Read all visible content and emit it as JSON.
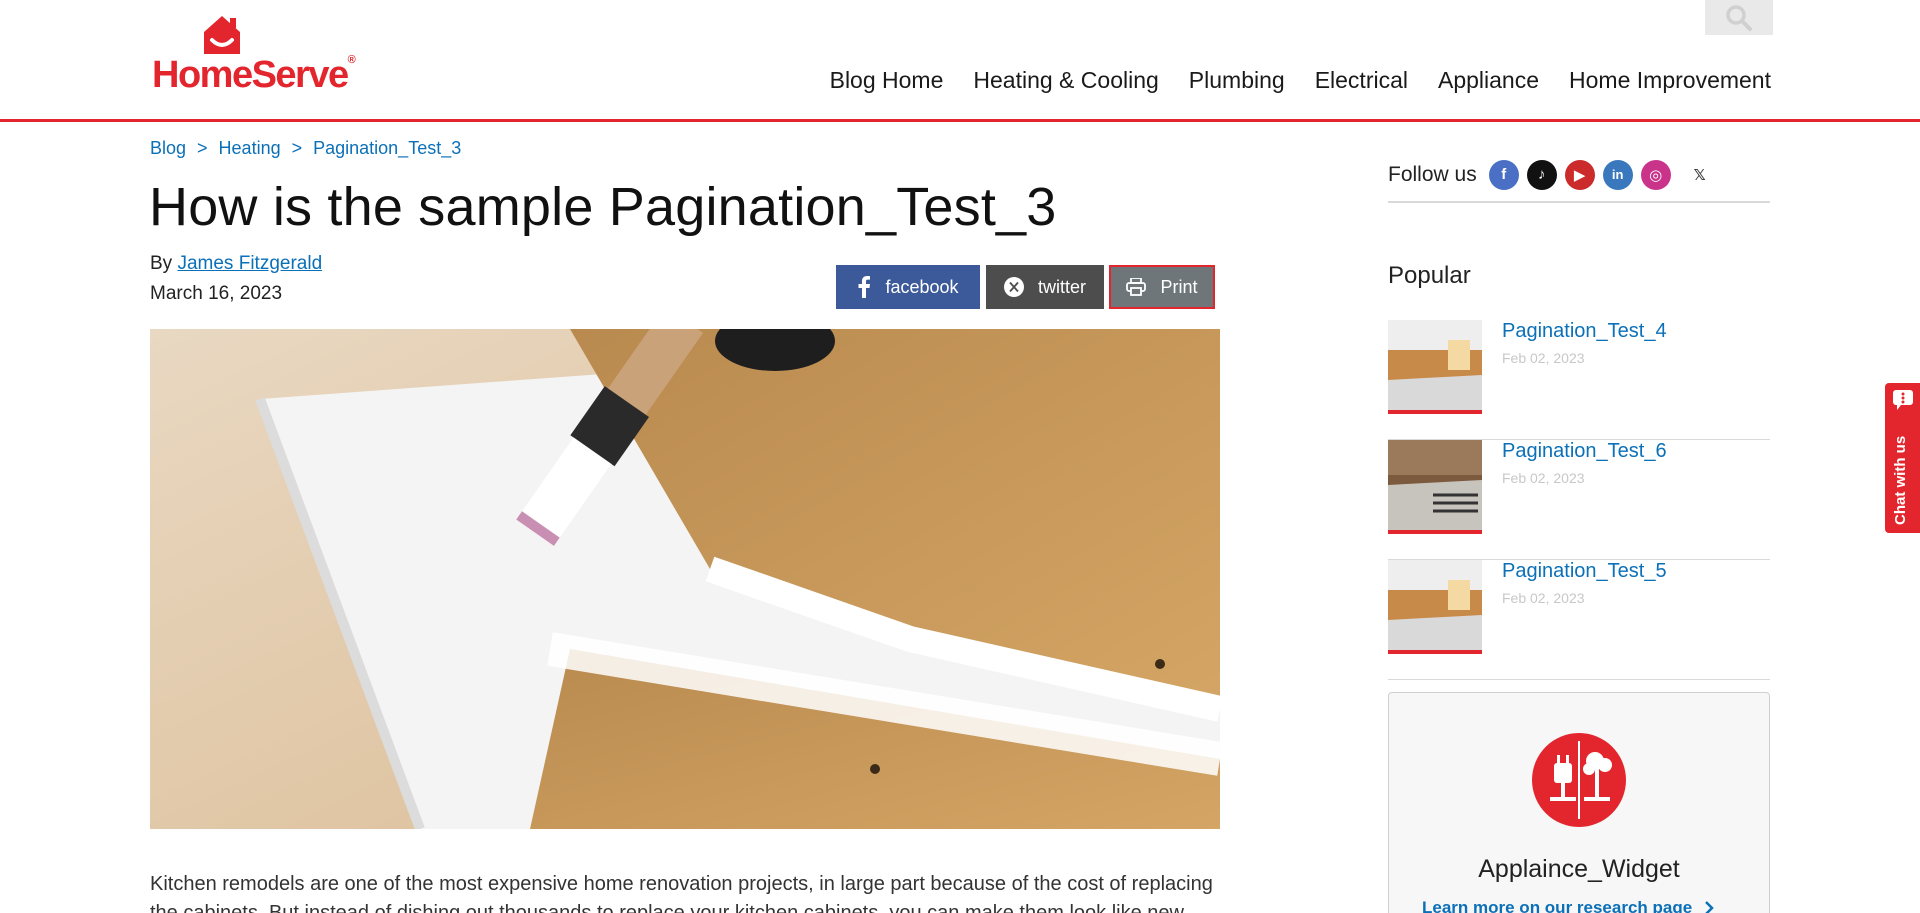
{
  "brand": {
    "name": "HomeServe",
    "accent": "#e3262e",
    "link": "#0b70b8"
  },
  "header": {
    "nav": [
      "Blog Home",
      "Heating & Cooling",
      "Plumbing",
      "Electrical",
      "Appliance",
      "Home Improvement"
    ],
    "search_icon": "search-icon"
  },
  "breadcrumb": {
    "items": [
      "Blog",
      "Heating",
      "Pagination_Test_3"
    ],
    "separator": ">"
  },
  "article": {
    "title": "How is the sample Pagination_Test_3",
    "by": "By",
    "author": "James Fitzgerald",
    "date": "March 16, 2023",
    "share": {
      "facebook": "facebook",
      "twitter": "twitter",
      "print": "Print"
    },
    "body": "Kitchen remodels are one of the most expensive home renovation projects, in large part because of the cost of replacing the cabinets. But instead of dishing out thousands to replace your kitchen cabinets, you can make them look like new"
  },
  "sidebar": {
    "follow_label": "Follow us",
    "social": [
      "facebook-icon",
      "tiktok-icon",
      "youtube-icon",
      "linkedin-icon",
      "instagram-icon",
      "x-icon"
    ],
    "popular_title": "Popular",
    "popular": [
      {
        "title": "Pagination_Test_4",
        "date": "Feb 02, 2023"
      },
      {
        "title": "Pagination_Test_6",
        "date": "Feb 02, 2023"
      },
      {
        "title": "Pagination_Test_5",
        "date": "Feb 02, 2023"
      }
    ],
    "widget": {
      "title": "Applaince_Widget",
      "link": "Learn more on our research page"
    }
  },
  "chat": {
    "label": "Chat with us"
  }
}
